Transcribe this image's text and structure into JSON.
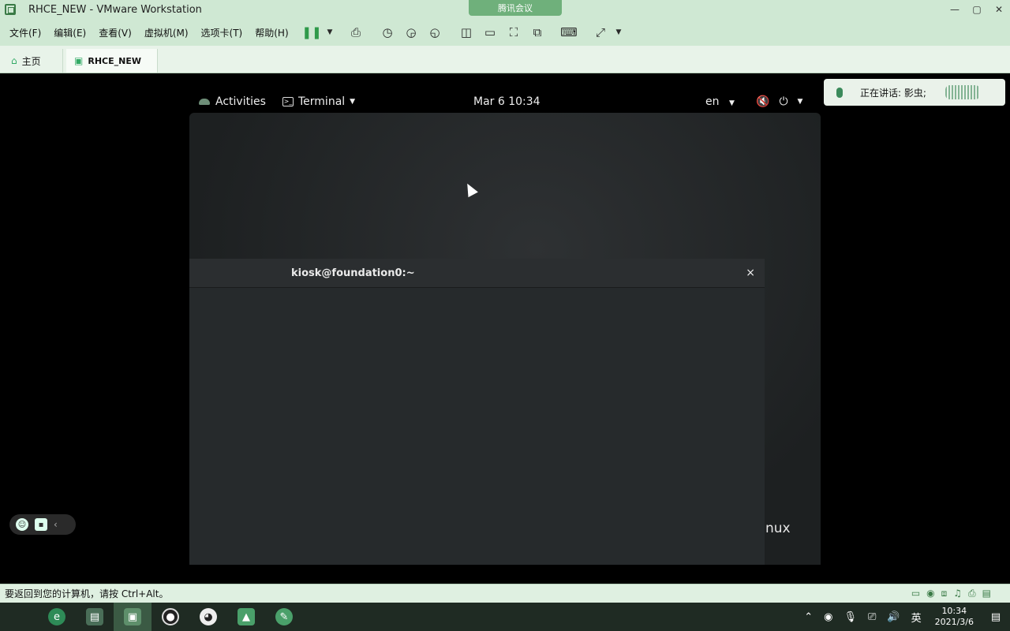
{
  "window": {
    "title": "RHCE_NEW - VMware Workstation",
    "meeting_badge": "腾讯会议",
    "controls": [
      "—",
      "▢",
      "✕"
    ]
  },
  "menubar": {
    "items": [
      "文件(F)",
      "编辑(E)",
      "查看(V)",
      "虚拟机(M)",
      "选项卡(T)",
      "帮助(H)"
    ]
  },
  "tabs": [
    {
      "label": "主页"
    },
    {
      "label": "RHCE_NEW"
    }
  ],
  "gnome": {
    "activities": "Activities",
    "app_menu": "Terminal",
    "clock": "Mar 6  10:34",
    "language": "en"
  },
  "terminal": {
    "title": "kiosk@foundation0:~",
    "close": "×"
  },
  "desktop": {
    "brand_fragment": "nux"
  },
  "meeting": {
    "speaking": "正在讲话: 影虫;"
  },
  "statusbar": {
    "text": "要返回到您的计算机，请按 Ctrl+Alt。"
  },
  "taskbar": {
    "ime": "英",
    "time": "10:34",
    "date": "2021/3/6"
  },
  "colors": {
    "vmware_chrome": "#cfe8d3",
    "taskbar": "#1f2b23",
    "terminal_bg": "#26292b"
  }
}
